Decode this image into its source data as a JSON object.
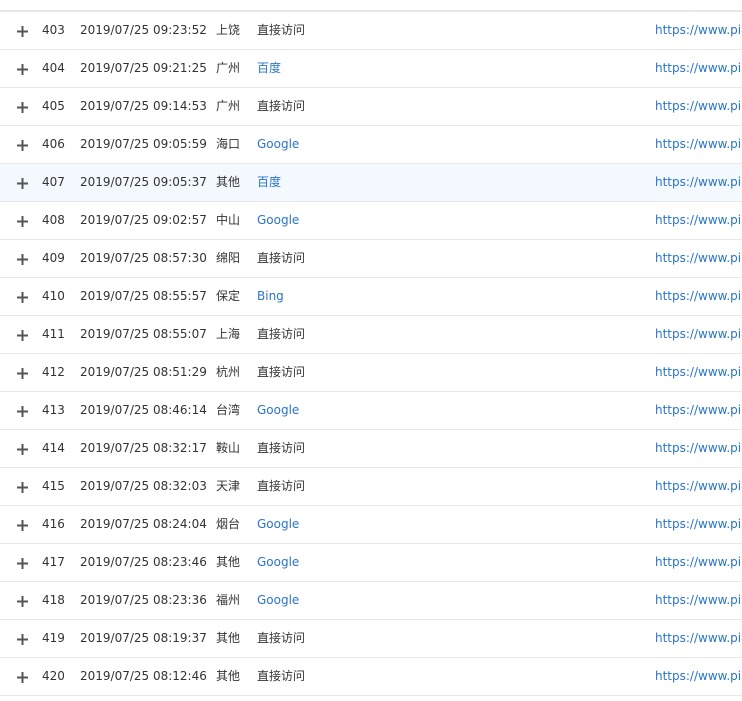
{
  "colors": {
    "link": "#2a74c9",
    "text": "#333333",
    "row_highlight": "#f4f8ff",
    "border": "#e8e8e8"
  },
  "icons": {
    "expand": "plus-icon"
  },
  "rows": [
    {
      "num": "403",
      "time": "2019/07/25 09:23:52",
      "city": "上饶",
      "source": "直接访问",
      "source_link": false,
      "url": "https://www.pian",
      "highlight": false
    },
    {
      "num": "404",
      "time": "2019/07/25 09:21:25",
      "city": "广州",
      "source": "百度",
      "source_link": true,
      "url": "https://www.pian",
      "highlight": false
    },
    {
      "num": "405",
      "time": "2019/07/25 09:14:53",
      "city": "广州",
      "source": "直接访问",
      "source_link": false,
      "url": "https://www.pian",
      "highlight": false
    },
    {
      "num": "406",
      "time": "2019/07/25 09:05:59",
      "city": "海口",
      "source": "Google",
      "source_link": true,
      "url": "https://www.pian",
      "highlight": false
    },
    {
      "num": "407",
      "time": "2019/07/25 09:05:37",
      "city": "其他",
      "source": "百度",
      "source_link": true,
      "url": "https://www.pian",
      "highlight": true
    },
    {
      "num": "408",
      "time": "2019/07/25 09:02:57",
      "city": "中山",
      "source": "Google",
      "source_link": true,
      "url": "https://www.pian",
      "highlight": false
    },
    {
      "num": "409",
      "time": "2019/07/25 08:57:30",
      "city": "绵阳",
      "source": "直接访问",
      "source_link": false,
      "url": "https://www.pian",
      "highlight": false
    },
    {
      "num": "410",
      "time": "2019/07/25 08:55:57",
      "city": "保定",
      "source": "Bing",
      "source_link": true,
      "url": "https://www.pian",
      "highlight": false
    },
    {
      "num": "411",
      "time": "2019/07/25 08:55:07",
      "city": "上海",
      "source": "直接访问",
      "source_link": false,
      "url": "https://www.pian",
      "highlight": false
    },
    {
      "num": "412",
      "time": "2019/07/25 08:51:29",
      "city": "杭州",
      "source": "直接访问",
      "source_link": false,
      "url": "https://www.pian",
      "highlight": false
    },
    {
      "num": "413",
      "time": "2019/07/25 08:46:14",
      "city": "台湾",
      "source": "Google",
      "source_link": true,
      "url": "https://www.pian",
      "highlight": false
    },
    {
      "num": "414",
      "time": "2019/07/25 08:32:17",
      "city": "鞍山",
      "source": "直接访问",
      "source_link": false,
      "url": "https://www.pian",
      "highlight": false
    },
    {
      "num": "415",
      "time": "2019/07/25 08:32:03",
      "city": "天津",
      "source": "直接访问",
      "source_link": false,
      "url": "https://www.pian",
      "highlight": false
    },
    {
      "num": "416",
      "time": "2019/07/25 08:24:04",
      "city": "烟台",
      "source": "Google",
      "source_link": true,
      "url": "https://www.pian",
      "highlight": false
    },
    {
      "num": "417",
      "time": "2019/07/25 08:23:46",
      "city": "其他",
      "source": "Google",
      "source_link": true,
      "url": "https://www.pian",
      "highlight": false
    },
    {
      "num": "418",
      "time": "2019/07/25 08:23:36",
      "city": "福州",
      "source": "Google",
      "source_link": true,
      "url": "https://www.pian",
      "highlight": false
    },
    {
      "num": "419",
      "time": "2019/07/25 08:19:37",
      "city": "其他",
      "source": "直接访问",
      "source_link": false,
      "url": "https://www.pian",
      "highlight": false
    },
    {
      "num": "420",
      "time": "2019/07/25 08:12:46",
      "city": "其他",
      "source": "直接访问",
      "source_link": false,
      "url": "https://www.pian",
      "highlight": false
    }
  ]
}
